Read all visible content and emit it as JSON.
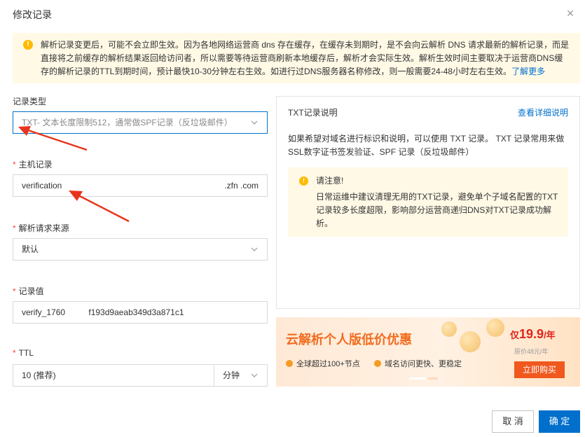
{
  "dialog": {
    "title": "修改记录"
  },
  "notice": {
    "text": "解析记录变更后，可能不会立即生效。因为各地网络运营商 dns 存在缓存，在缓存未到期时，是不会向云解析 DNS 请求最新的解析记录，而是直接将之前缓存的解析结果返回给访问者，所以需要等待运营商刷新本地缓存后，解析才会实际生效。解析生效时间主要取决于运营商DNS缓存的解析记录的TTL到期时间，预计最快10-30分钟左右生效。如进行过DNS服务器名称修改，则一般需要24-48小时左右生效。",
    "link": "了解更多"
  },
  "form": {
    "record_type": {
      "label": "记录类型",
      "value": "TXT- 文本长度限制512，通常做SPF记录（反垃圾邮件）"
    },
    "host": {
      "label": "主机记录",
      "value": "verification",
      "suffix": ".zfn   .com"
    },
    "source": {
      "label": "解析请求来源",
      "value": "默认"
    },
    "record_value": {
      "label": "记录值",
      "value": "verify_1760          f193d9aeab349d3a871c1"
    },
    "ttl": {
      "label": "TTL",
      "value": "10 (推荐)",
      "unit": "分钟"
    },
    "required_mark": "*"
  },
  "side_panel": {
    "title": "TXT记录说明",
    "link": "查看详细说明",
    "desc": "如果希望对域名进行标识和说明，可以使用 TXT 记录。 TXT 记录常用来做 SSL数字证书签发验证、SPF 记录（反垃圾邮件）",
    "tip_title": "请注意!",
    "tip_body": "日常运维中建议清理无用的TXT记录，避免单个子域名配置的TXT记录较多长度超限，影响部分运营商递归DNS对TXT记录成功解析。"
  },
  "banner": {
    "title": "云解析个人版低价优惠",
    "feature1": "全球超过100+节点",
    "feature2": "域名访问更快、更稳定",
    "price_prefix": "仅",
    "price": "19.9",
    "price_unit": "/年",
    "original_price": "原价48元/年",
    "buy_label": "立即购买"
  },
  "footer": {
    "cancel_label": "取 消",
    "ok_label": "确 定"
  },
  "colors": {
    "primary": "#0070cc",
    "notice_bg": "#fff9e6",
    "warn": "#ffbb00",
    "required": "#f54743",
    "promo": "#f26b1d",
    "arrow": "#e8341c"
  }
}
